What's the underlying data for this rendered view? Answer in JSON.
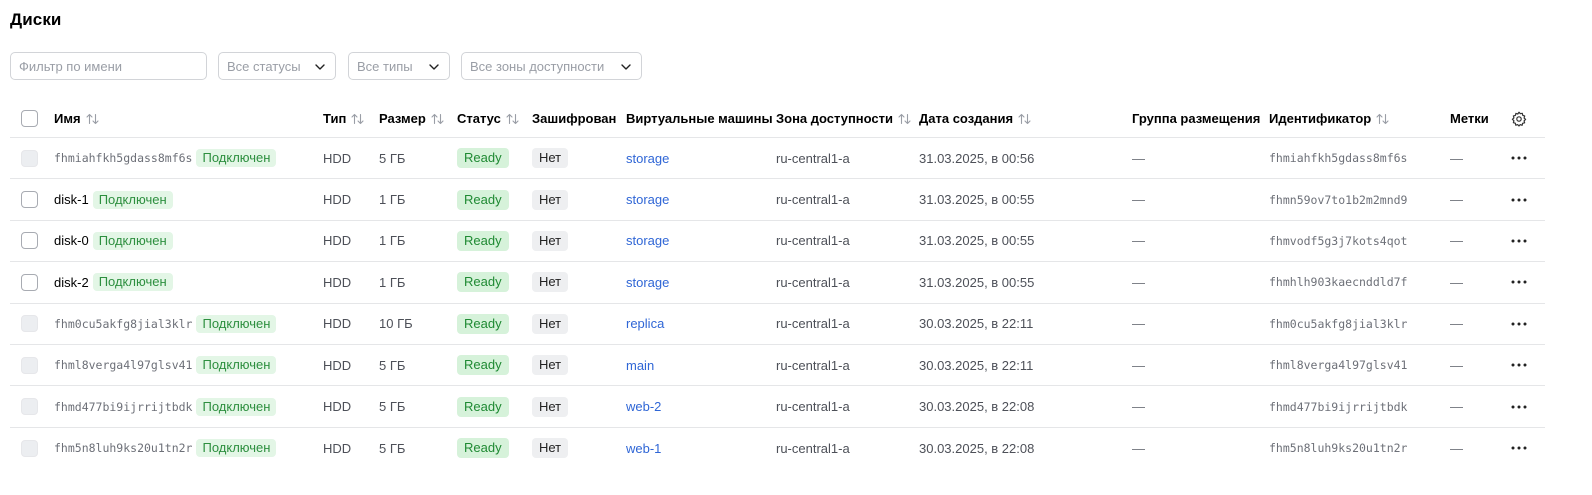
{
  "page": {
    "title": "Диски"
  },
  "filters": {
    "name_placeholder": "Фильтр по имени",
    "status_value": "Все статусы",
    "type_value": "Все типы",
    "zone_value": "Все зоны доступности"
  },
  "columns": {
    "name": "Имя",
    "type": "Тип",
    "size": "Размер",
    "status": "Статус",
    "encrypted": "Зашифрован",
    "vms": "Виртуальные машины",
    "zone": "Зона доступности",
    "created": "Дата создания",
    "placement": "Группа размещения",
    "id": "Идентификатор",
    "labels": "Метки"
  },
  "icons": {
    "sort": "sort-arrows-icon",
    "settings": "gear-icon",
    "actions": "more-horizontal-icon",
    "dropdown": "chevron-down-icon"
  },
  "colors": {
    "link": "#2f66d6",
    "ready_bg": "#d6f2da",
    "ready_text": "#1f8a33",
    "connected_bg": "#e3f6e6",
    "connected_text": "#2d8f3f"
  },
  "rows": [
    {
      "name": "fhmiahfkh5gdass8mf6s",
      "name_is_id": true,
      "attached": "Подключен",
      "type": "HDD",
      "size": "5 ГБ",
      "status": "Ready",
      "encrypted": "Нет",
      "vm": "storage",
      "zone": "ru-central1-a",
      "created": "31.03.2025, в 00:56",
      "placement": "—",
      "id": "fhmiahfkh5gdass8mf6s",
      "labels": "—"
    },
    {
      "name": "disk-1",
      "name_is_id": false,
      "attached": "Подключен",
      "type": "HDD",
      "size": "1 ГБ",
      "status": "Ready",
      "encrypted": "Нет",
      "vm": "storage",
      "zone": "ru-central1-a",
      "created": "31.03.2025, в 00:55",
      "placement": "—",
      "id": "fhmn59ov7to1b2m2mnd9",
      "labels": "—"
    },
    {
      "name": "disk-0",
      "name_is_id": false,
      "attached": "Подключен",
      "type": "HDD",
      "size": "1 ГБ",
      "status": "Ready",
      "encrypted": "Нет",
      "vm": "storage",
      "zone": "ru-central1-a",
      "created": "31.03.2025, в 00:55",
      "placement": "—",
      "id": "fhmvodf5g3j7kots4qot",
      "labels": "—"
    },
    {
      "name": "disk-2",
      "name_is_id": false,
      "attached": "Подключен",
      "type": "HDD",
      "size": "1 ГБ",
      "status": "Ready",
      "encrypted": "Нет",
      "vm": "storage",
      "zone": "ru-central1-a",
      "created": "31.03.2025, в 00:55",
      "placement": "—",
      "id": "fhmhlh903kaecnddld7f",
      "labels": "—"
    },
    {
      "name": "fhm0cu5akfg8jial3klr",
      "name_is_id": true,
      "attached": "Подключен",
      "type": "HDD",
      "size": "10 ГБ",
      "status": "Ready",
      "encrypted": "Нет",
      "vm": "replica",
      "zone": "ru-central1-a",
      "created": "30.03.2025, в 22:11",
      "placement": "—",
      "id": "fhm0cu5akfg8jial3klr",
      "labels": "—"
    },
    {
      "name": "fhml8verga4l97glsv41",
      "name_is_id": true,
      "attached": "Подключен",
      "type": "HDD",
      "size": "5 ГБ",
      "status": "Ready",
      "encrypted": "Нет",
      "vm": "main",
      "zone": "ru-central1-a",
      "created": "30.03.2025, в 22:11",
      "placement": "—",
      "id": "fhml8verga4l97glsv41",
      "labels": "—"
    },
    {
      "name": "fhmd477bi9ijrrijtbdk",
      "name_is_id": true,
      "attached": "Подключен",
      "type": "HDD",
      "size": "5 ГБ",
      "status": "Ready",
      "encrypted": "Нет",
      "vm": "web-2",
      "zone": "ru-central1-a",
      "created": "30.03.2025, в 22:08",
      "placement": "—",
      "id": "fhmd477bi9ijrrijtbdk",
      "labels": "—"
    },
    {
      "name": "fhm5n8luh9ks20u1tn2r",
      "name_is_id": true,
      "attached": "Подключен",
      "type": "HDD",
      "size": "5 ГБ",
      "status": "Ready",
      "encrypted": "Нет",
      "vm": "web-1",
      "zone": "ru-central1-a",
      "created": "30.03.2025, в 22:08",
      "placement": "—",
      "id": "fhm5n8luh9ks20u1tn2r",
      "labels": "—"
    }
  ]
}
